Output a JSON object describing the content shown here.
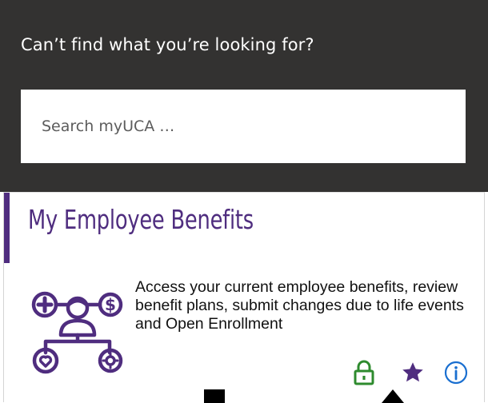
{
  "search": {
    "heading": "Can’t find what you’re looking for?",
    "placeholder": "Search myUCA …"
  },
  "card": {
    "title": "My Employee Benefits",
    "description": "Access your current employee benefits, review benefit plans, submit changes due to life events and Open Enrollment",
    "icons": {
      "main": "employee-benefits-icon",
      "lock": "lock-icon",
      "favorite": "star-icon",
      "info": "info-icon"
    }
  },
  "colors": {
    "panel_bg": "#333231",
    "brand_purple": "#4f2d7f",
    "lock_green": "#2e8b2e",
    "info_blue": "#1a6fd0"
  }
}
